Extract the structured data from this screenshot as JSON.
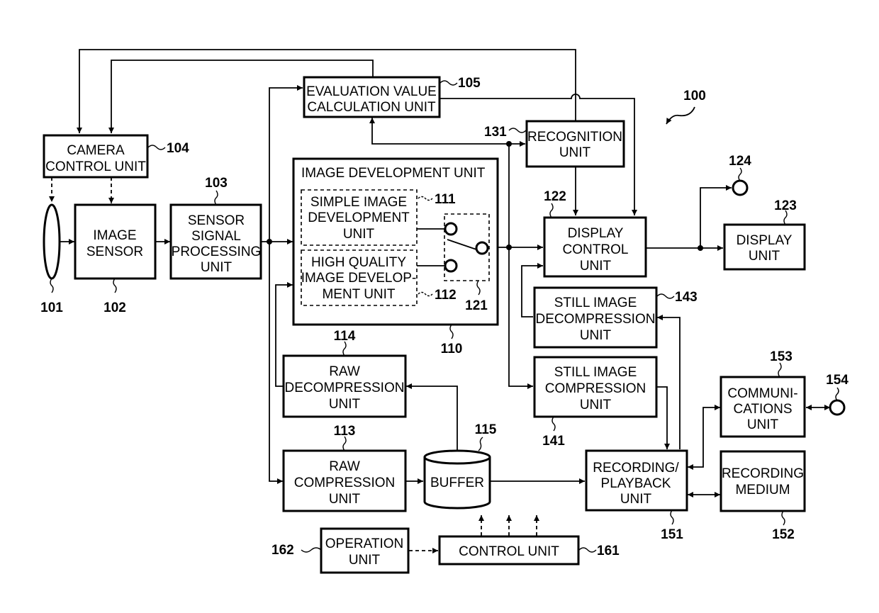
{
  "figure": {
    "system_ref": "100",
    "blocks": {
      "lens": {
        "ref": "101"
      },
      "image_sensor": {
        "ref": "102",
        "lines": [
          "IMAGE",
          "SENSOR"
        ]
      },
      "sensor_signal": {
        "ref": "103",
        "lines": [
          "SENSOR",
          "SIGNAL",
          "PROCESSING",
          "UNIT"
        ]
      },
      "camera_control": {
        "ref": "104",
        "lines": [
          "CAMERA",
          "CONTROL UNIT"
        ]
      },
      "evaluation": {
        "ref": "105",
        "lines": [
          "EVALUATION VALUE",
          "CALCULATION UNIT"
        ]
      },
      "image_development": {
        "ref": "110",
        "title": "IMAGE DEVELOPMENT UNIT"
      },
      "simple_dev": {
        "ref": "111",
        "lines": [
          "SIMPLE IMAGE",
          "DEVELOPMENT",
          "UNIT"
        ]
      },
      "hq_dev": {
        "ref": "112",
        "lines": [
          "HIGH QUALITY",
          "IMAGE DEVELOP-",
          "MENT UNIT"
        ]
      },
      "raw_compression": {
        "ref": "113",
        "lines": [
          "RAW",
          "COMPRESSION",
          "UNIT"
        ]
      },
      "raw_decompression": {
        "ref": "114",
        "lines": [
          "RAW",
          "DECOMPRESSION",
          "UNIT"
        ]
      },
      "buffer": {
        "ref": "115",
        "lines": [
          "BUFFER"
        ]
      },
      "switch": {
        "ref": "121"
      },
      "display_control": {
        "ref": "122",
        "lines": [
          "DISPLAY",
          "CONTROL",
          "UNIT"
        ]
      },
      "display_unit": {
        "ref": "123",
        "lines": [
          "DISPLAY",
          "UNIT"
        ]
      },
      "video_out_terminal": {
        "ref": "124"
      },
      "recognition": {
        "ref": "131",
        "lines": [
          "RECOGNITION",
          "UNIT"
        ]
      },
      "still_compression": {
        "ref": "141",
        "lines": [
          "STILL IMAGE",
          "COMPRESSION",
          "UNIT"
        ]
      },
      "still_decompression": {
        "ref": "143",
        "lines": [
          "STILL IMAGE",
          "DECOMPRESSION",
          "UNIT"
        ]
      },
      "recording_playback": {
        "ref": "151",
        "lines": [
          "RECORDING/",
          "PLAYBACK",
          "UNIT"
        ]
      },
      "recording_medium": {
        "ref": "152",
        "lines": [
          "RECORDING",
          "MEDIUM"
        ]
      },
      "communications": {
        "ref": "153",
        "lines": [
          "COMMUNI-",
          "CATIONS",
          "UNIT"
        ]
      },
      "comm_terminal": {
        "ref": "154"
      },
      "control_unit": {
        "ref": "161",
        "lines": [
          "CONTROL UNIT"
        ]
      },
      "operation_unit": {
        "ref": "162",
        "lines": [
          "OPERATION",
          "UNIT"
        ]
      }
    }
  }
}
